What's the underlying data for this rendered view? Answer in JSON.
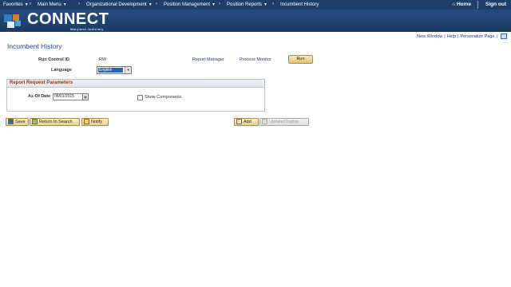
{
  "topnav": {
    "favorites": "Favorites",
    "main_menu": "Main Menu",
    "crumbs": [
      "Organizational Development",
      "Position Management",
      "Position Reports",
      "Incumbent History"
    ],
    "home": "Home",
    "signout": "Sign out"
  },
  "banner": {
    "brand": "CONNECT",
    "sub": "Maryland Judiciary"
  },
  "toplinks": {
    "new_window": "New Window",
    "help": "Help",
    "personalize": "Personalize Page"
  },
  "page": {
    "title": "Incumbent History",
    "run_control_label": "Run Control ID",
    "run_control_value": "RW",
    "report_manager": "Report Manager",
    "process_monitor": "Process Monitor",
    "run": "Run",
    "language_label": "Language",
    "language_value": "English"
  },
  "params": {
    "title": "Report Request Parameters",
    "as_of_date_label": "As Of Date",
    "as_of_date_value": "06/01/2015",
    "show_components": "Show Components",
    "show_components_checked": false
  },
  "toolbar": {
    "save": "Save",
    "return_to_search": "Return to Search",
    "notify": "Notify",
    "add": "Add",
    "update_display": "Update/Display"
  },
  "colors": {
    "nav": "#1f3f6b",
    "banner": "#254d80",
    "title": "#1f4e8c",
    "group_title": "#8c3a14",
    "button": "#ecd08a"
  }
}
